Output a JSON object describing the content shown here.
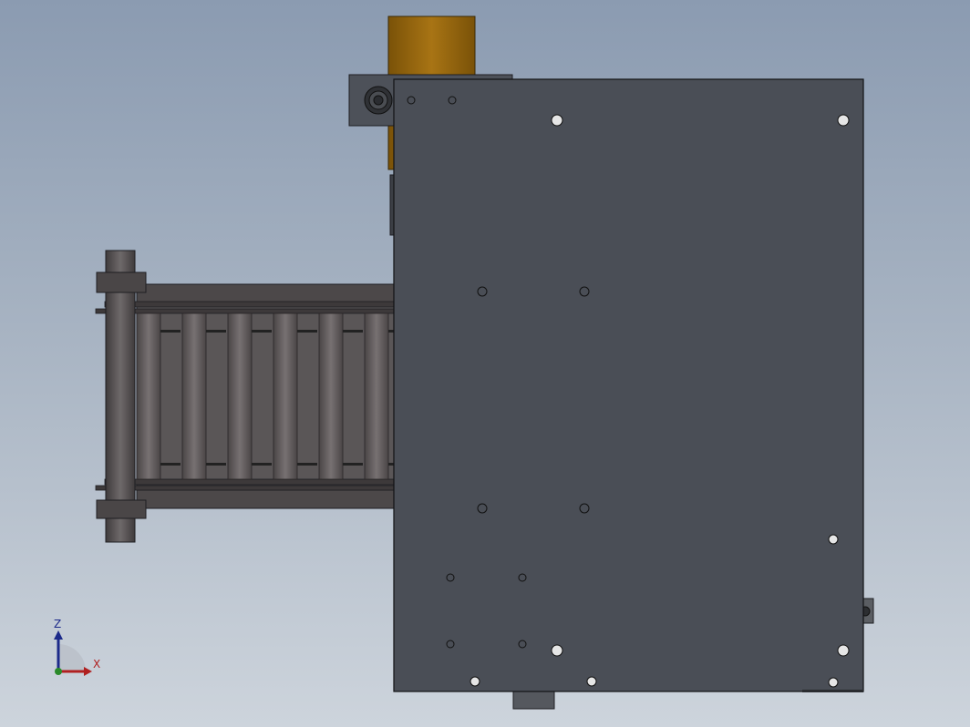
{
  "viewport": {
    "background_top": "#8b9bb1",
    "background_bottom": "#cdd4dc"
  },
  "model": {
    "plate_color": "#4a4e56",
    "motor_color": "#9c6a12",
    "chain_color": "#595556",
    "hole_color": "#e6e6e6"
  },
  "triad": {
    "z_label": "Z",
    "x_label": "X",
    "z_color": "#1c2a8a",
    "x_color": "#b02020"
  }
}
